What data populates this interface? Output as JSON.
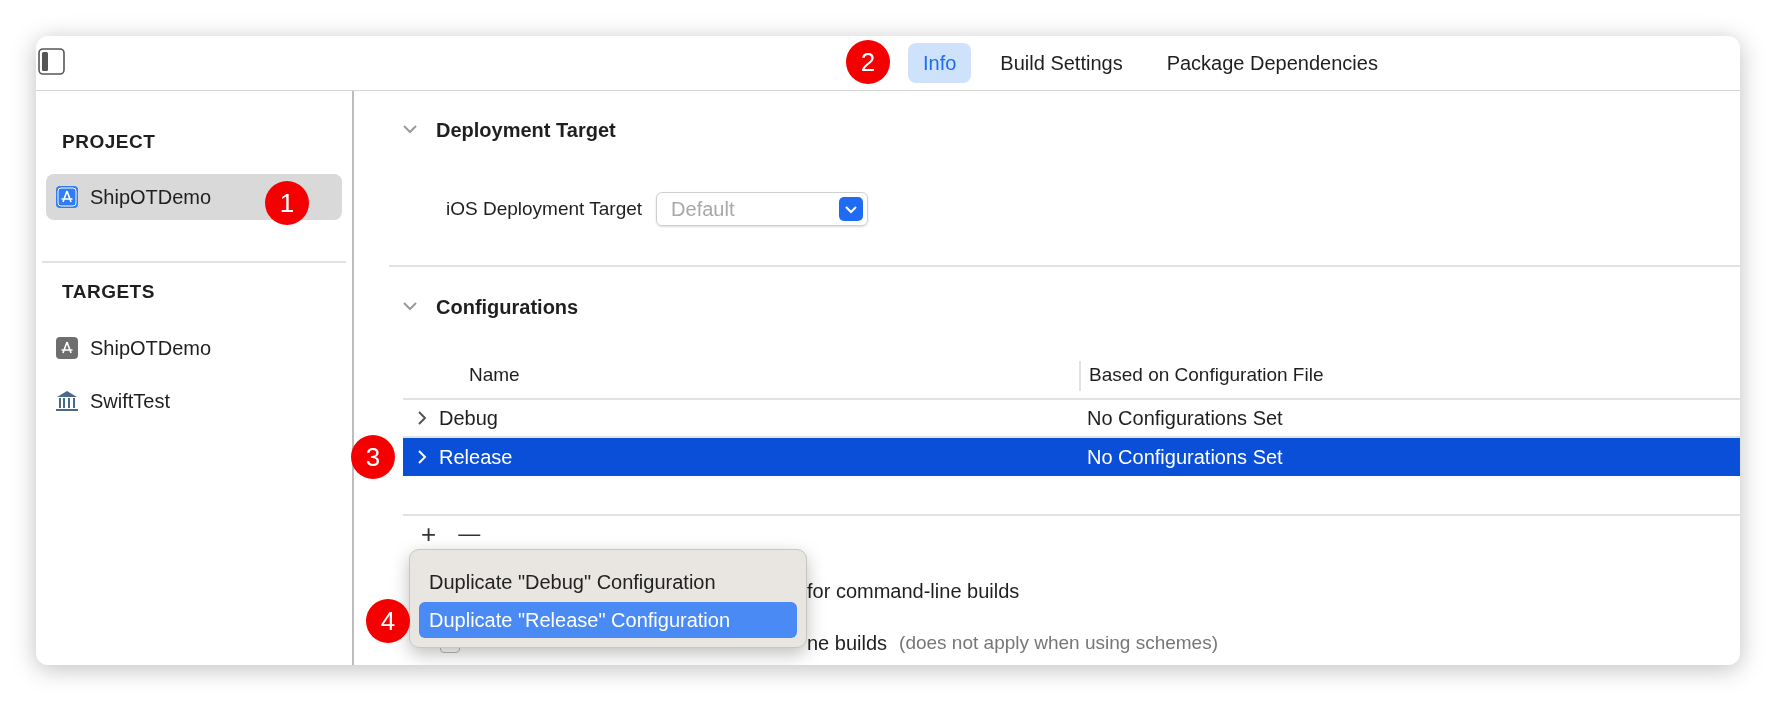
{
  "toolbar": {
    "tabs": [
      {
        "label": "Info",
        "selected": true
      },
      {
        "label": "Build Settings",
        "selected": false
      },
      {
        "label": "Package Dependencies",
        "selected": false
      }
    ]
  },
  "sidebar": {
    "sections": [
      {
        "title": "PROJECT",
        "items": [
          {
            "label": "ShipOTDemo",
            "kind": "project",
            "selected": true
          }
        ]
      },
      {
        "title": "TARGETS",
        "items": [
          {
            "label": "ShipOTDemo",
            "kind": "app",
            "selected": false
          },
          {
            "label": "SwiftTest",
            "kind": "framework",
            "selected": false
          }
        ]
      }
    ]
  },
  "deployment": {
    "title": "Deployment Target",
    "expanded": true,
    "field_label": "iOS Deployment Target",
    "placeholder": "Default"
  },
  "configurations": {
    "title": "Configurations",
    "expanded": true,
    "columns": [
      "Name",
      "Based on Configuration File"
    ],
    "rows": [
      {
        "name": "Debug",
        "file": "No Configurations Set",
        "selected": false,
        "expanded": false
      },
      {
        "name": "Release",
        "file": "No Configurations Set",
        "selected": true,
        "expanded": false
      }
    ],
    "add_button": "+",
    "remove_button": "—"
  },
  "options": [
    {
      "text": "for command-line builds"
    },
    {
      "text": "ne builds",
      "checked": false,
      "note": "(does not apply when using schemes)"
    }
  ],
  "menu": {
    "items": [
      {
        "label": "Duplicate \"Debug\" Configuration",
        "selected": false
      },
      {
        "label": "Duplicate \"Release\" Configuration",
        "selected": true
      }
    ]
  },
  "annotations": [
    {
      "number": "1"
    },
    {
      "number": "2"
    },
    {
      "number": "3"
    },
    {
      "number": "4"
    }
  ]
}
